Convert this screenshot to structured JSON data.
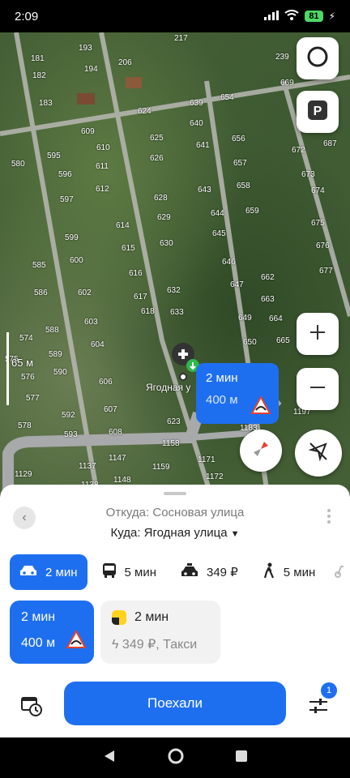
{
  "status_bar": {
    "time": "2:09",
    "battery": "81"
  },
  "map": {
    "plot_numbers": [
      "193",
      "217",
      "181",
      "206",
      "239",
      "182",
      "194",
      "669",
      "183",
      "624",
      "639",
      "654",
      "687",
      "609",
      "640",
      "672",
      "595",
      "610",
      "625",
      "641",
      "656",
      "670",
      "580",
      "596",
      "611",
      "626",
      "657",
      "673",
      "612",
      "628",
      "643",
      "658",
      "674",
      "597",
      "614",
      "629",
      "644",
      "659",
      "675",
      "599",
      "630",
      "645",
      "676",
      "585",
      "600",
      "615",
      "616",
      "646",
      "677",
      "662",
      "586",
      "602",
      "617",
      "632",
      "647",
      "663",
      "603",
      "618",
      "633",
      "649",
      "664",
      "574",
      "588",
      "604",
      "650",
      "665",
      "575",
      "589",
      "576",
      "590",
      "606",
      "577",
      "592",
      "607",
      "578",
      "593",
      "608",
      "623",
      "1158",
      "1129",
      "1137",
      "1147",
      "1159",
      "1171",
      "1138",
      "1148",
      "1172",
      "1183",
      "1197"
    ],
    "scale_label": "65 м",
    "poi_label": "Ягодная у",
    "route_bubble": {
      "time": "2 мин",
      "distance": "400 м"
    }
  },
  "sheet": {
    "from": "Откуда: Сосновая улица",
    "to": "Куда: Ягодная улица",
    "modes": [
      {
        "icon": "car-icon",
        "label": "2 мин",
        "active": true
      },
      {
        "icon": "bus-icon",
        "label": "5 мин",
        "active": false
      },
      {
        "icon": "taxi-icon",
        "label": "349 ₽",
        "active": false
      },
      {
        "icon": "walk-icon",
        "label": "5 мин",
        "active": false
      }
    ],
    "route_card": {
      "time": "2 мин",
      "distance": "400 м"
    },
    "taxi_card": {
      "time": "2 мин",
      "price": "349 ₽, Такси"
    },
    "go_button": "Поехали",
    "settings_badge": "1"
  },
  "colors": {
    "accent": "#1e6ff0",
    "taxi_yellow": "#ffd21e"
  }
}
